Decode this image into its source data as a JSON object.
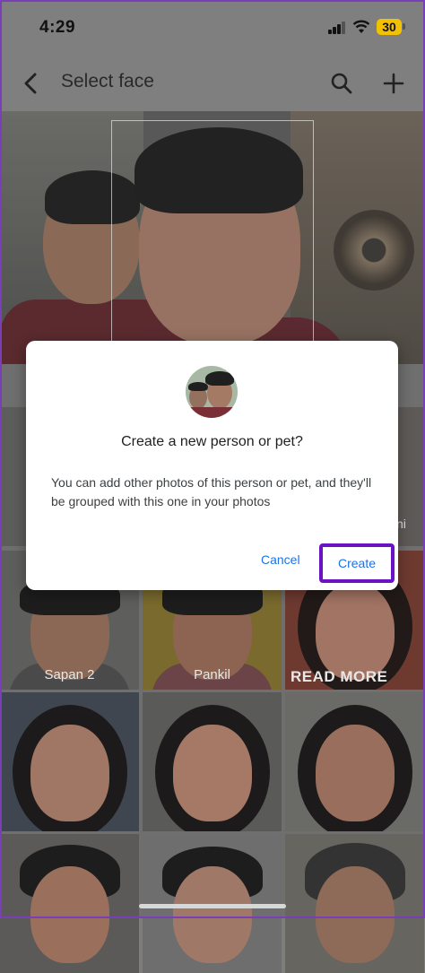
{
  "status_bar": {
    "time": "4:29",
    "battery": "30",
    "icons": [
      "signal-icon",
      "wifi-icon",
      "battery-icon"
    ]
  },
  "app_bar": {
    "title": "Select face",
    "icons": [
      "back-arrow-icon",
      "search-icon",
      "add-icon"
    ]
  },
  "grid": {
    "labels": [
      "Sapan 2",
      "Pankil"
    ],
    "side_label": "ni",
    "overlay_text": "READ MORE"
  },
  "dialog": {
    "title": "Create a new person or pet?",
    "body": "You can add other photos of this person or pet, and they'll be grouped with this one in your photos",
    "cancel_label": "Cancel",
    "create_label": "Create"
  },
  "colors": {
    "accent": "#1a73e8",
    "highlight": "#6b12c4",
    "battery": "#f2c200"
  }
}
